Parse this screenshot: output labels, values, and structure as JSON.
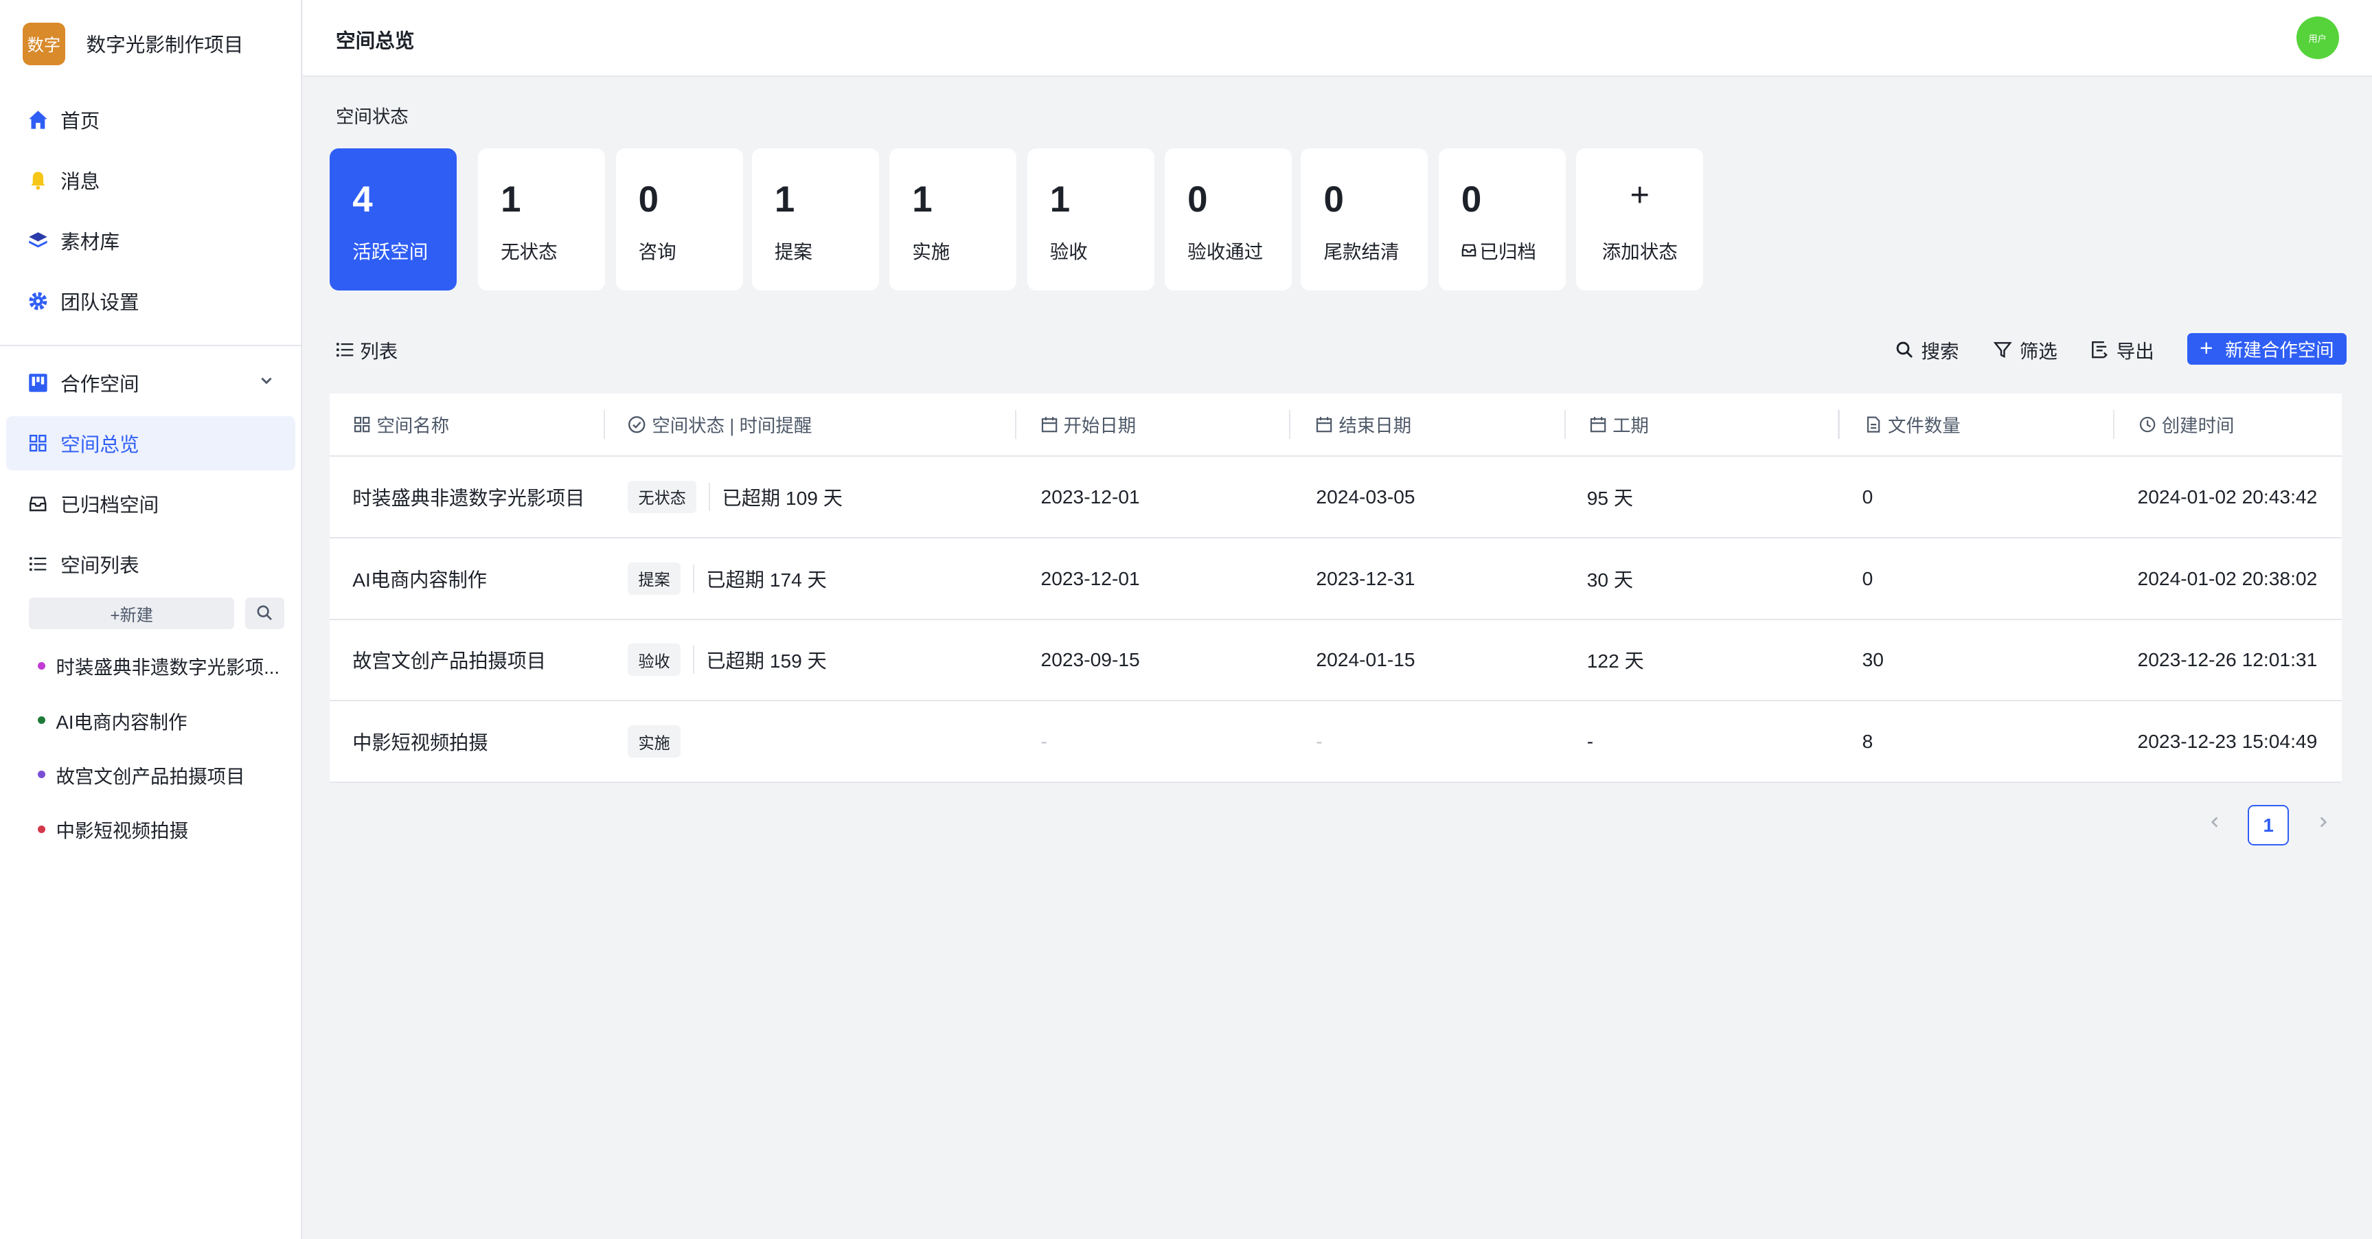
{
  "app": {
    "logo_text": "数字",
    "name": "数字光影制作项目"
  },
  "nav": [
    {
      "label": "首页",
      "icon": "home-icon"
    },
    {
      "label": "消息",
      "icon": "bell-icon"
    },
    {
      "label": "素材库",
      "icon": "layers-icon"
    },
    {
      "label": "团队设置",
      "icon": "gear-icon"
    }
  ],
  "workspace_nav": {
    "group_label": "合作空间",
    "overview_label": "空间总览",
    "archived_label": "已归档空间",
    "list_label": "空间列表",
    "new_label": "+新建",
    "spaces": [
      {
        "label": "时装盛典非遗数字光影项...",
        "color": "#c23bd4"
      },
      {
        "label": "AI电商内容制作",
        "color": "#1f7a3a"
      },
      {
        "label": "故宫文创产品拍摄项目",
        "color": "#7a4fd4"
      },
      {
        "label": "中影短视频拍摄",
        "color": "#d4384a"
      }
    ]
  },
  "header": {
    "title": "空间总览",
    "avatar_text": "用户"
  },
  "status": {
    "section_title": "空间状态",
    "cards": [
      {
        "count": "4",
        "label": "活跃空间"
      },
      {
        "count": "1",
        "label": "无状态"
      },
      {
        "count": "0",
        "label": "咨询"
      },
      {
        "count": "1",
        "label": "提案"
      },
      {
        "count": "1",
        "label": "实施"
      },
      {
        "count": "1",
        "label": "验收"
      },
      {
        "count": "0",
        "label": "验收通过"
      },
      {
        "count": "0",
        "label": "尾款结清"
      },
      {
        "count": "0",
        "label": "已归档"
      }
    ],
    "add_label": "添加状态"
  },
  "list": {
    "title": "列表",
    "search_label": "搜索",
    "filter_label": "筛选",
    "export_label": "导出",
    "new_space_label": "新建合作空间"
  },
  "table": {
    "columns": [
      "空间名称",
      "空间状态 | 时间提醒",
      "开始日期",
      "结束日期",
      "工期",
      "文件数量",
      "创建时间"
    ],
    "rows": [
      {
        "name": "时装盛典非遗数字光影项目",
        "status": "无状态",
        "reminder": "已超期 109 天",
        "start": "2023-12-01",
        "end": "2024-03-05",
        "duration": "95 天",
        "files": "0",
        "created": "2024-01-02 20:43:42"
      },
      {
        "name": "AI电商内容制作",
        "status": "提案",
        "reminder": "已超期 174 天",
        "start": "2023-12-01",
        "end": "2023-12-31",
        "duration": "30 天",
        "files": "0",
        "created": "2024-01-02 20:38:02"
      },
      {
        "name": "故宫文创产品拍摄项目",
        "status": "验收",
        "reminder": "已超期 159 天",
        "start": "2023-09-15",
        "end": "2024-01-15",
        "duration": "122 天",
        "files": "30",
        "created": "2023-12-26 12:01:31"
      },
      {
        "name": "中影短视频拍摄",
        "status": "实施",
        "reminder": "",
        "start": "-",
        "end": "-",
        "duration": "-",
        "files": "8",
        "created": "2023-12-23 15:04:49"
      }
    ]
  },
  "pagination": {
    "current": "1"
  },
  "colors": {
    "primary": "#2f5ef5",
    "avatar": "#56d33a",
    "logo": "#d98a2b"
  }
}
